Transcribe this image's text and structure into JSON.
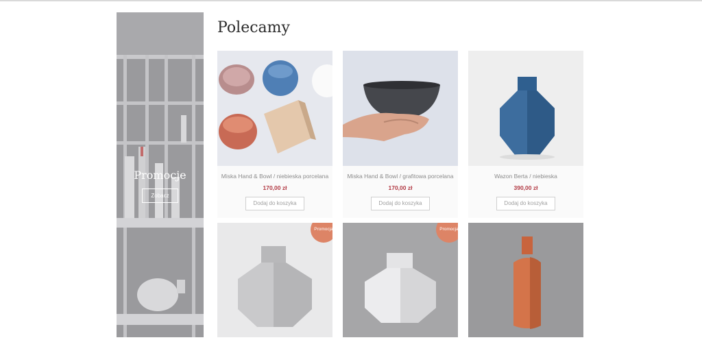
{
  "section": {
    "title": "Polecamy"
  },
  "promo": {
    "title": "Promocje",
    "button": "Zobacz"
  },
  "products": [
    {
      "name": "Miska Hand & Bowl / niebieska porcelana",
      "price": "170,00 zł",
      "button": "Dodaj do koszyka",
      "badge": ""
    },
    {
      "name": "Miska Hand & Bowl / grafitowa porcelana",
      "price": "170,00 zł",
      "button": "Dodaj do koszyka",
      "badge": ""
    },
    {
      "name": "Wazon Berta / niebieska",
      "price": "390,00 zł",
      "button": "Dodaj do koszyka",
      "badge": ""
    },
    {
      "name": "",
      "price": "",
      "button": "",
      "badge": "Promocja"
    },
    {
      "name": "",
      "price": "",
      "button": "",
      "badge": "Promocja"
    },
    {
      "name": "",
      "price": "",
      "button": "",
      "badge": ""
    }
  ],
  "colors": {
    "price": "#b23a44",
    "badge": "#dd8466",
    "promo_overlay": "#8f8f92"
  }
}
